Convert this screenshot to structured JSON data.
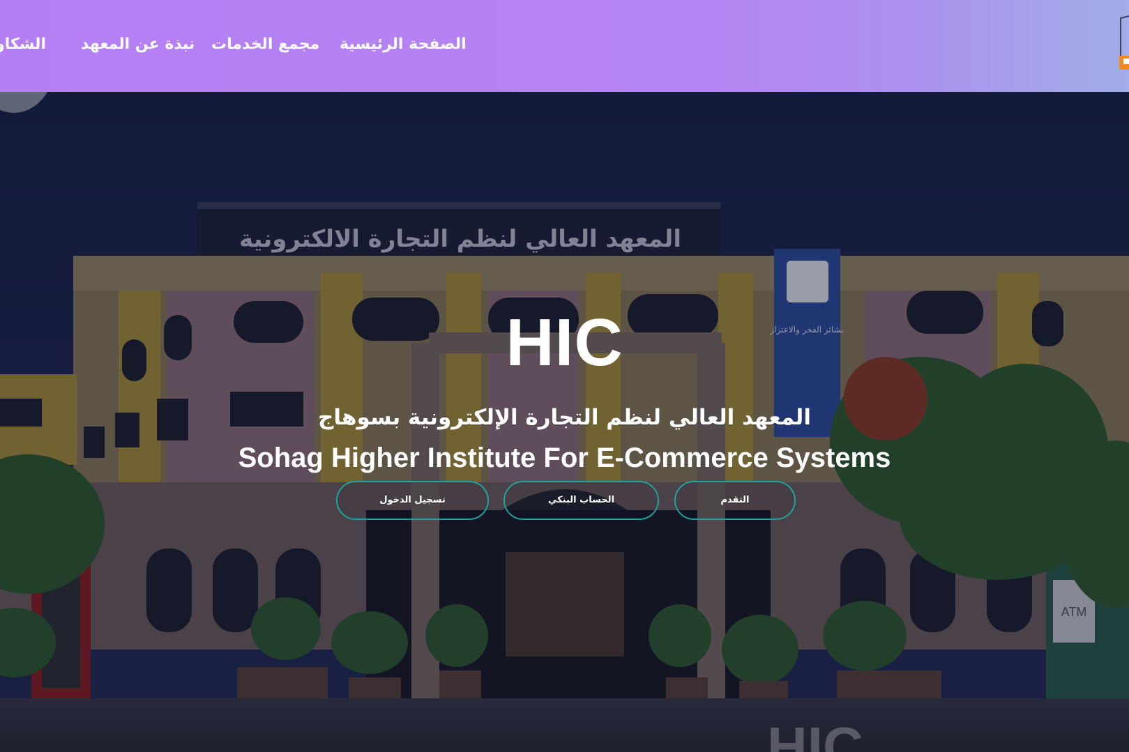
{
  "nav": {
    "items": [
      {
        "label": "الصفحة الرئيسية"
      },
      {
        "label": "مجمع الخدمات"
      },
      {
        "label": "نبذة عن المعهد"
      },
      {
        "label": "الشكاوى"
      }
    ]
  },
  "hero": {
    "title": "HIC",
    "subtitle_ar": "المعهد العالي لنظم التجارة الإلكترونية بسوهاج",
    "subtitle_en": "Sohag Higher Institute For E-Commerce Systems",
    "buttons": {
      "login": "تسجيل الدخول",
      "bank": "الحساب البنكي",
      "apply": "التقدم"
    },
    "watermark": "HIC",
    "building_sign": "المعهد العالي لنظم التجارة الالكترونية",
    "banner_text": "بشائر الفخر والاعتزاز",
    "atm_label": "ATM"
  },
  "colors": {
    "nav_bg": "#b47ff3",
    "button_border": "#1fa39a",
    "text": "#ffffff"
  }
}
